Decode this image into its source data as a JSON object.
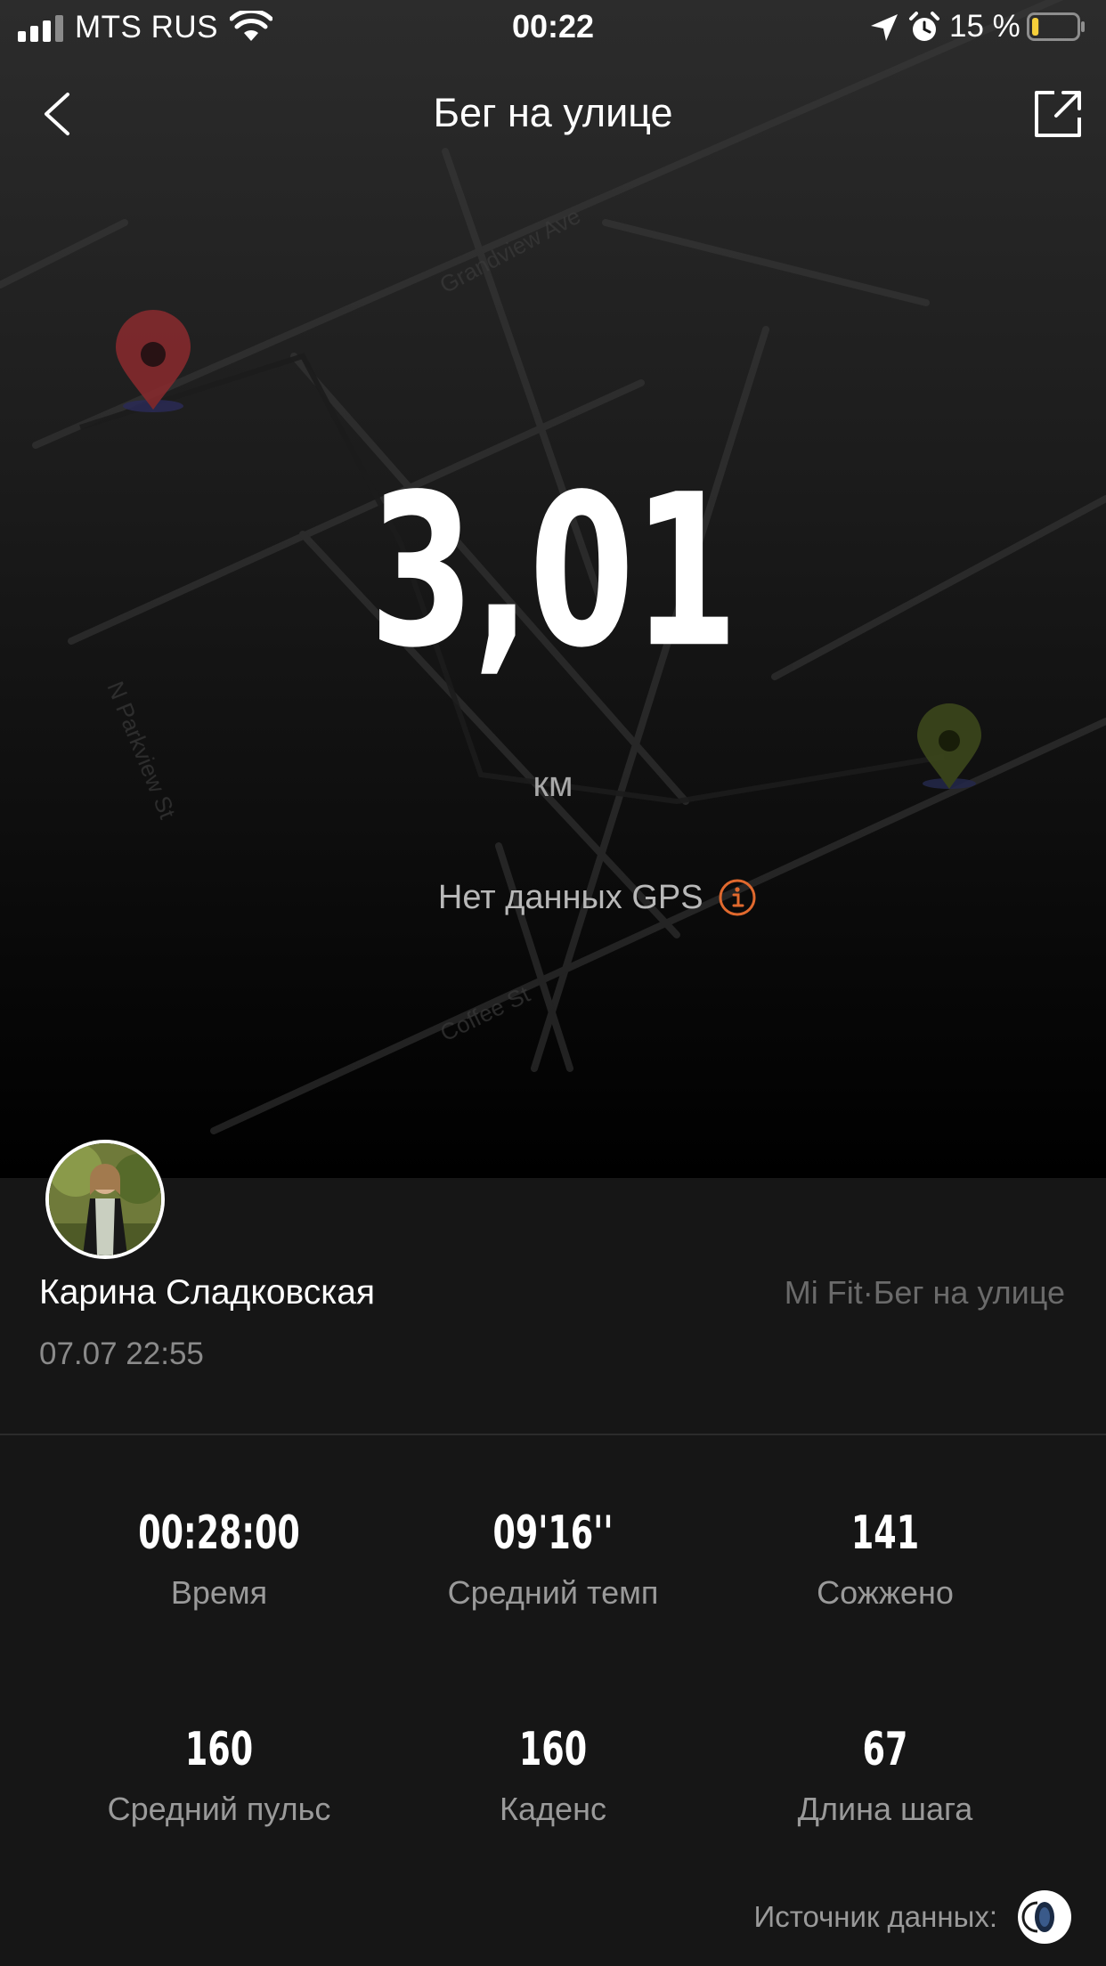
{
  "status_bar": {
    "carrier": "MTS RUS",
    "time": "00:22",
    "battery_percent": "15 %",
    "battery_level": 0.15
  },
  "nav": {
    "title": "Бег на улице",
    "back_icon": "chevron-left-icon",
    "share_icon": "share-export-icon"
  },
  "map": {
    "street_labels": [
      "Grandview Ave",
      "N Parkview St",
      "Coffee St"
    ]
  },
  "summary": {
    "distance": "3,01",
    "unit": "км",
    "gps_notice": "Нет данных GPS"
  },
  "profile": {
    "name": "Карина Сладковская",
    "date": "07.07 22:55",
    "source": "Mi Fit·Бег на улице"
  },
  "stats": [
    {
      "value": "00:28:00",
      "label": "Время"
    },
    {
      "value": "09'16''",
      "label": "Средний темп"
    },
    {
      "value": "141",
      "label": "Сожжено"
    },
    {
      "value": "160",
      "label": "Средний пульс"
    },
    {
      "value": "160",
      "label": "Каденс"
    },
    {
      "value": "67",
      "label": "Длина шага"
    }
  ],
  "data_source": {
    "label": "Источник данных:",
    "device_icon": "fitness-band-icon"
  },
  "colors": {
    "accent": "#e0692e",
    "background": "#161616",
    "start_pin": "#8a2a2e",
    "end_pin": "#3e4a1c"
  }
}
